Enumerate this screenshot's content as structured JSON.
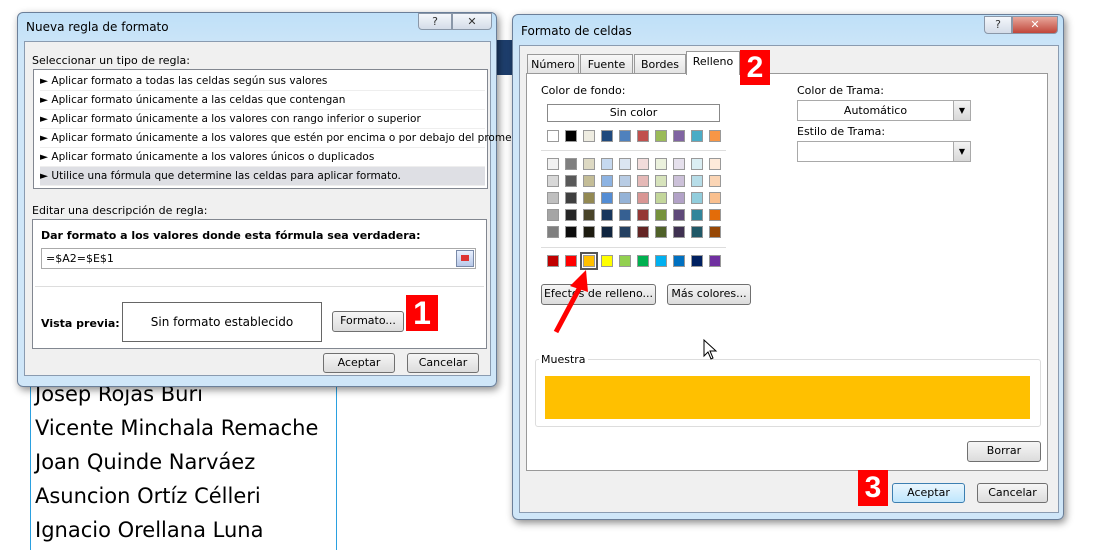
{
  "background_sheet": {
    "names": [
      "Josep Rojas Buri",
      "Vicente Minchala Remache",
      "Joan Quinde Narváez",
      "Asuncion Ortíz Célleri",
      "Ignacio Orellana Luna"
    ]
  },
  "rule_dialog": {
    "title": "Nueva regla de formato",
    "help_label": "?",
    "close_label": "✕",
    "select_type_label": "Seleccionar un tipo de regla:",
    "rule_types": [
      "► Aplicar formato a todas las celdas según sus valores",
      "► Aplicar formato únicamente a las celdas que contengan",
      "► Aplicar formato únicamente a los valores con rango inferior o superior",
      "► Aplicar formato únicamente a los valores que estén por encima o por debajo del promedio",
      "► Aplicar formato únicamente a los valores únicos o duplicados",
      "► Utilice una fórmula que determine las celdas para aplicar formato."
    ],
    "selected_rule_index": 5,
    "edit_label": "Editar una descripción de regla:",
    "formula_label": "Dar formato a los valores donde esta fórmula sea verdadera:",
    "formula_value": "=$A2=$E$1",
    "preview_label": "Vista previa:",
    "preview_text": "Sin formato establecido",
    "format_button": "Formato...",
    "ok_button": "Aceptar",
    "cancel_button": "Cancelar"
  },
  "cells_dialog": {
    "title": "Formato de celdas",
    "help_label": "?",
    "close_label": "✕",
    "tabs": [
      "Número",
      "Fuente",
      "Bordes",
      "Relleno"
    ],
    "active_tab": "Relleno",
    "background_color_label": "Color de fondo:",
    "no_color_button": "Sin color",
    "theme_colors": [
      "#FFFFFF",
      "#000000",
      "#EEECE1",
      "#1F497D",
      "#4F81BD",
      "#C0504D",
      "#9BBB59",
      "#8064A2",
      "#4BACC6",
      "#F79646"
    ],
    "tint_rows": [
      [
        "#F2F2F2",
        "#7F7F7F",
        "#DDD9C3",
        "#C6D9F0",
        "#DBE5F1",
        "#F2DCDB",
        "#EBF1DD",
        "#E5E0EC",
        "#DBEEF3",
        "#FDEADA"
      ],
      [
        "#D8D8D8",
        "#595959",
        "#C4BD97",
        "#8DB3E2",
        "#B8CCE4",
        "#E5B9B7",
        "#D7E3BC",
        "#CCC1D9",
        "#B7DDE8",
        "#FBD5B5"
      ],
      [
        "#BFBFBF",
        "#3F3F3F",
        "#938953",
        "#548DD4",
        "#95B3D7",
        "#D99694",
        "#C3D69B",
        "#B2A2C7",
        "#92CDDC",
        "#FAC08F"
      ],
      [
        "#A5A5A5",
        "#262626",
        "#494429",
        "#17365D",
        "#366092",
        "#953734",
        "#76923C",
        "#5F497A",
        "#31859B",
        "#E36C09"
      ],
      [
        "#7F7F7F",
        "#0C0C0C",
        "#1D1B10",
        "#0F243E",
        "#244061",
        "#632423",
        "#4F6128",
        "#3F3151",
        "#205867",
        "#974806"
      ]
    ],
    "standard_colors": [
      "#C00000",
      "#FF0000",
      "#FFC000",
      "#FFFF00",
      "#92D050",
      "#00B050",
      "#00B0F0",
      "#0070C0",
      "#002060",
      "#7030A0"
    ],
    "selected_standard_index": 2,
    "fill_effects_button": "Efectos de relleno...",
    "more_colors_button": "Más colores...",
    "pattern_color_label": "Color de Trama:",
    "pattern_color_value": "Automático",
    "pattern_style_label": "Estilo de Trama:",
    "pattern_style_value": "",
    "sample_label": "Muestra",
    "sample_color": "#FFC000",
    "clear_button": "Borrar",
    "ok_button": "Aceptar",
    "cancel_button": "Cancelar"
  },
  "annotations": {
    "step1": "1",
    "step2": "2",
    "step3": "3",
    "arrow_color": "#FF0000"
  }
}
